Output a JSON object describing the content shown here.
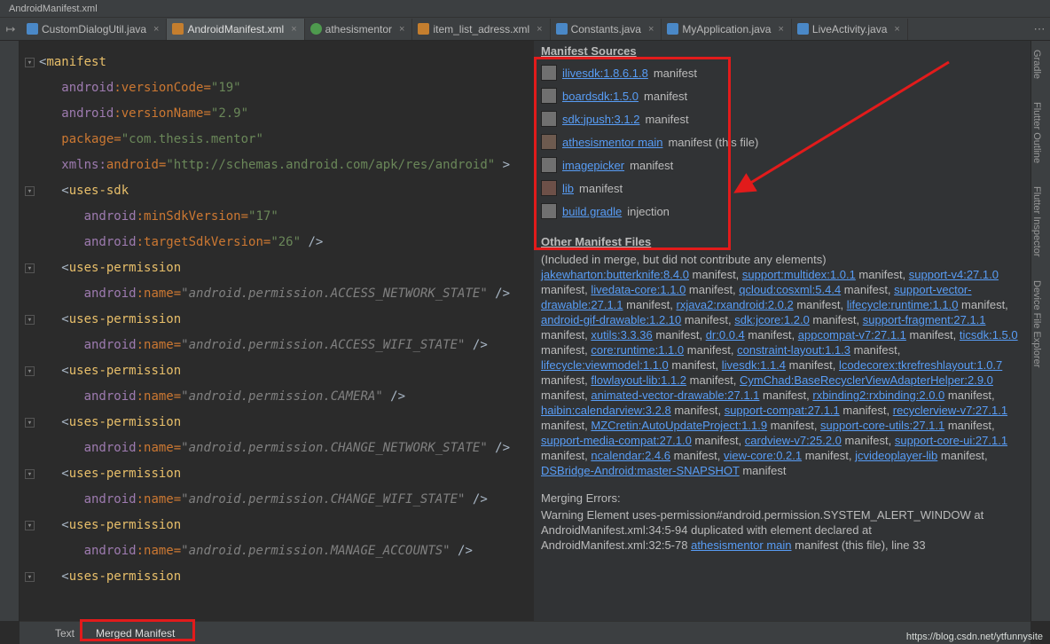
{
  "breadcrumb": "AndroidManifest.xml",
  "tabs": [
    {
      "label": "CustomDialogUtil.java",
      "active": false,
      "icon": "java"
    },
    {
      "label": "AndroidManifest.xml",
      "active": true,
      "icon": "xml"
    },
    {
      "label": "athesismentor",
      "active": false,
      "icon": "target"
    },
    {
      "label": "item_list_adress.xml",
      "active": false,
      "icon": "xml"
    },
    {
      "label": "Constants.java",
      "active": false,
      "icon": "java"
    },
    {
      "label": "MyApplication.java",
      "active": false,
      "icon": "java"
    },
    {
      "label": "LiveActivity.java",
      "active": false,
      "icon": "java"
    }
  ],
  "right_tools": [
    "Gradle",
    "Flutter Outline",
    "Flutter Inspector",
    "Device File Explorer"
  ],
  "code": {
    "l1_tag": "manifest",
    "l2_attr1_ns": "android",
    "l2_attr1_name": ":versionCode=",
    "l2_attr1_val": "\"19\"",
    "l3_attr1_ns": "android",
    "l3_attr1_name": ":versionName=",
    "l3_attr1_val": "\"2.9\"",
    "l4_attr1_name": "package=",
    "l4_attr1_val": "\"com.thesis.mentor\"",
    "l5_attr1_ns": "xmlns:",
    "l5_attr1_name": "android=",
    "l5_attr1_val": "\"http://schemas.android.com/apk/res/android\"",
    "l5_close": " >",
    "l6_tag": "uses-sdk",
    "l7_attr1_ns": "android",
    "l7_attr1_name": ":minSdkVersion=",
    "l7_attr1_val": "\"17\"",
    "l8_attr1_ns": "android",
    "l8_attr1_name": ":targetSdkVersion=",
    "l8_attr1_val": "\"26\"",
    "l8_close": " />",
    "up_tag": "uses-permission",
    "p_name_ns": "android",
    "p_name_attr": ":name=",
    "perm1": "\"android.permission.ACCESS_NETWORK_STATE\"",
    "perm2": "\"android.permission.ACCESS_WIFI_STATE\"",
    "perm3": "\"android.permission.CAMERA\"",
    "perm4": "\"android.permission.CHANGE_NETWORK_STATE\"",
    "perm5": "\"android.permission.CHANGE_WIFI_STATE\"",
    "perm6": "\"android.permission.MANAGE_ACCOUNTS\"",
    "close_tag": " />"
  },
  "manifest_sources_title": "Manifest Sources",
  "sources": [
    {
      "swatch": "#707070",
      "link": "ilivesdk:1.8.6.1.8",
      "rest": " manifest"
    },
    {
      "swatch": "#707070",
      "link": "boardsdk:1.5.0",
      "rest": " manifest"
    },
    {
      "swatch": "#707070",
      "link": "sdk:jpush:3.1.2",
      "rest": " manifest"
    },
    {
      "swatch": "#6d5a4f",
      "link": "athesismentor main",
      "rest": " manifest (this file)"
    },
    {
      "swatch": "#707070",
      "link": "imagepicker",
      "rest": " manifest"
    },
    {
      "swatch": "#6d5048",
      "link": "lib",
      "rest": " manifest"
    },
    {
      "swatch": "#707070",
      "link": "build.gradle",
      "rest": " injection"
    }
  ],
  "other_title": "Other Manifest Files",
  "other_sub": "(Included in merge, but did not contribute any elements)",
  "other_items": [
    {
      "l": "jakewharton:butterknife:8.4.0",
      "r": " manifest, "
    },
    {
      "l": "support:multidex:1.0.1",
      "r": " manifest, "
    },
    {
      "l": "support-v4:27.1.0",
      "r": " manifest, "
    },
    {
      "l": "livedata-core:1.1.0",
      "r": " manifest, "
    },
    {
      "l": "qcloud:cosxml:5.4.4",
      "r": " manifest, "
    },
    {
      "l": "support-vector-drawable:27.1.1",
      "r": " manifest, "
    },
    {
      "l": "rxjava2:rxandroid:2.0.2",
      "r": " manifest, "
    },
    {
      "l": "lifecycle:runtime:1.1.0",
      "r": " manifest, "
    },
    {
      "l": "android-gif-drawable:1.2.10",
      "r": " manifest, "
    },
    {
      "l": "sdk:jcore:1.2.0",
      "r": " manifest, "
    },
    {
      "l": "support-fragment:27.1.1",
      "r": " manifest, "
    },
    {
      "l": "xutils:3.3.36",
      "r": " manifest, "
    },
    {
      "l": "dr:0.0.4",
      "r": " manifest, "
    },
    {
      "l": "appcompat-v7:27.1.1",
      "r": " manifest, "
    },
    {
      "l": "ticsdk:1.5.0",
      "r": " manifest, "
    },
    {
      "l": "core:runtime:1.1.0",
      "r": " manifest, "
    },
    {
      "l": "constraint-layout:1.1.3",
      "r": " manifest, "
    },
    {
      "l": "lifecycle:viewmodel:1.1.0",
      "r": " manifest, "
    },
    {
      "l": "livesdk:1.1.4",
      "r": " manifest, "
    },
    {
      "l": "lcodecorex:tkrefreshlayout:1.0.7",
      "r": " manifest, "
    },
    {
      "l": "flowlayout-lib:1.1.2",
      "r": " manifest, "
    },
    {
      "l": "CymChad:BaseRecyclerViewAdapterHelper:2.9.0",
      "r": " manifest, "
    },
    {
      "l": "animated-vector-drawable:27.1.1",
      "r": " manifest, "
    },
    {
      "l": "rxbinding2:rxbinding:2.0.0",
      "r": " manifest, "
    },
    {
      "l": "haibin:calendarview:3.2.8",
      "r": " manifest, "
    },
    {
      "l": "support-compat:27.1.1",
      "r": " manifest, "
    },
    {
      "l": "recyclerview-v7:27.1.1",
      "r": " manifest, "
    },
    {
      "l": "MZCretin:AutoUpdateProject:1.1.9",
      "r": " manifest, "
    },
    {
      "l": "support-core-utils:27.1.1",
      "r": " manifest, "
    },
    {
      "l": "support-media-compat:27.1.0",
      "r": " manifest, "
    },
    {
      "l": "cardview-v7:25.2.0",
      "r": " manifest, "
    },
    {
      "l": "support-core-ui:27.1.1",
      "r": " manifest, "
    },
    {
      "l": "ncalendar:2.4.6",
      "r": " manifest, "
    },
    {
      "l": "view-core:0.2.1",
      "r": " manifest, "
    },
    {
      "l": "jcvideoplayer-lib",
      "r": " manifest, "
    },
    {
      "l": "DSBridge-Android:master-SNAPSHOT",
      "r": " manifest"
    }
  ],
  "errors_title": "Merging Errors:",
  "errors_lines": [
    "Warning Element uses-permission#android.permission.SYSTEM_ALERT_WINDOW at",
    "AndroidManifest.xml:34:5-94 duplicated with element declared at",
    "AndroidManifest.xml:32:5-78 "
  ],
  "errors_link": "athesismentor main",
  "errors_tail": " manifest (this file), line 33",
  "bottom_tabs": [
    {
      "label": "Text",
      "active": false
    },
    {
      "label": "Merged Manifest",
      "active": true
    }
  ],
  "watermark": "https://blog.csdn.net/ytfunnysite"
}
